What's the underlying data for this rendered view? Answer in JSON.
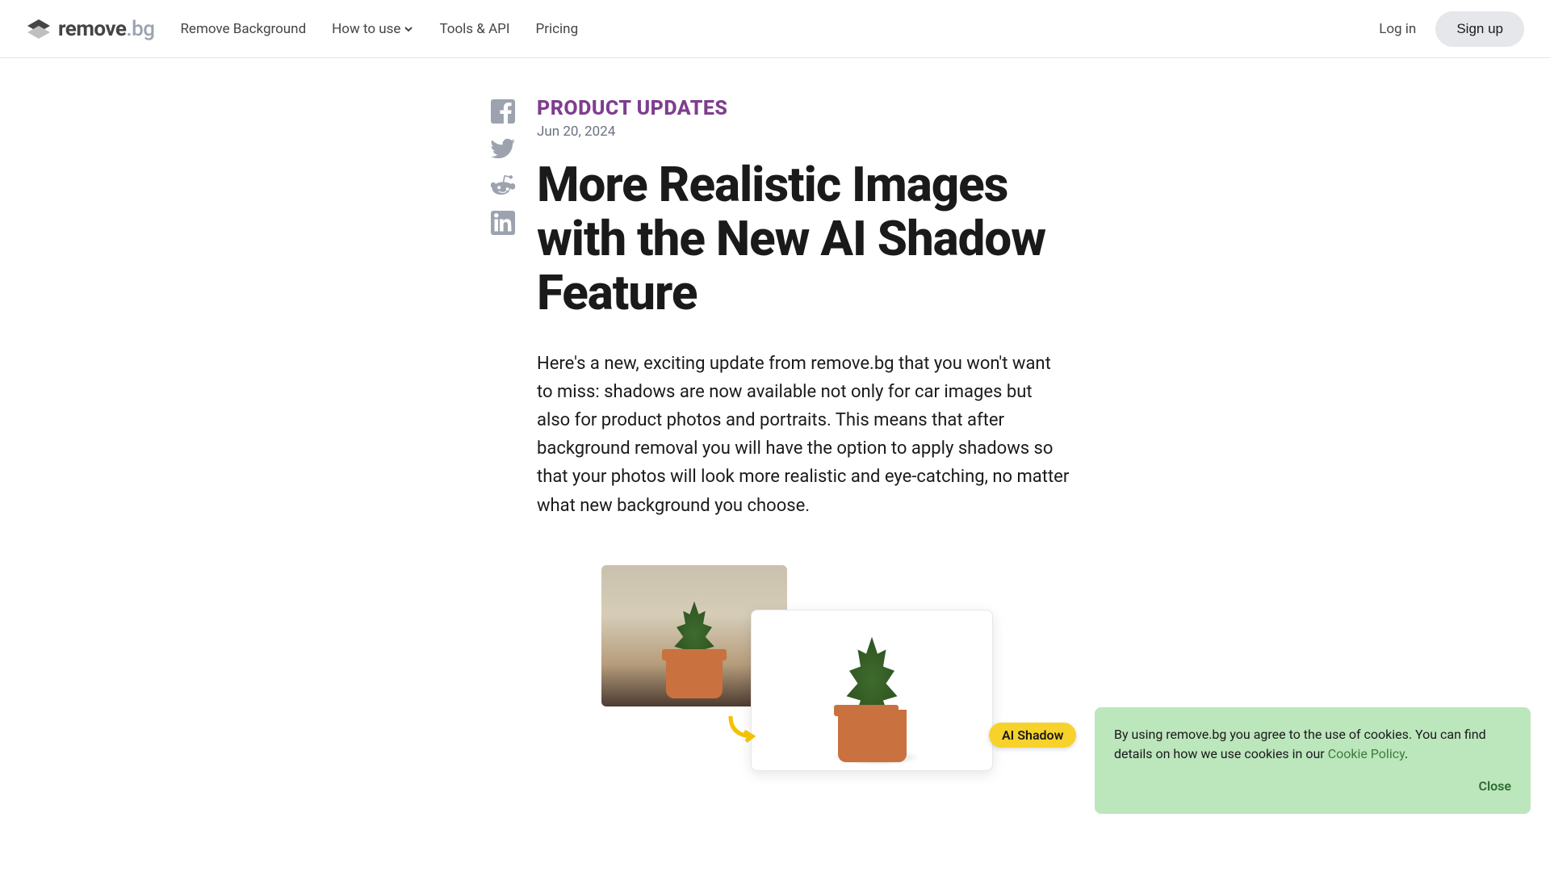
{
  "header": {
    "brand_main": "remove",
    "brand_suffix": ".bg",
    "nav": {
      "remove_bg": "Remove Background",
      "how_to_use": "How to use",
      "tools_api": "Tools & API",
      "pricing": "Pricing"
    },
    "login": "Log in",
    "signup": "Sign up"
  },
  "article": {
    "category": "PRODUCT UPDATES",
    "date": "Jun 20, 2024",
    "title": "More Realistic Images with the New AI Shadow Feature",
    "body": "Here's a new, exciting update from remove.bg that you won't want to miss: shadows are now available not only for car images but also for product photos and portraits. This means that after background removal you will have the option to apply shadows so that your photos will look more realistic and eye-catching, no matter what new background you choose.",
    "badge_label": "AI Shadow"
  },
  "cookie": {
    "text_before": "By using remove.bg you agree to the use of cookies. You can find details on how we use cookies in our ",
    "policy_label": "Cookie Policy",
    "text_after": ".",
    "close": "Close"
  }
}
